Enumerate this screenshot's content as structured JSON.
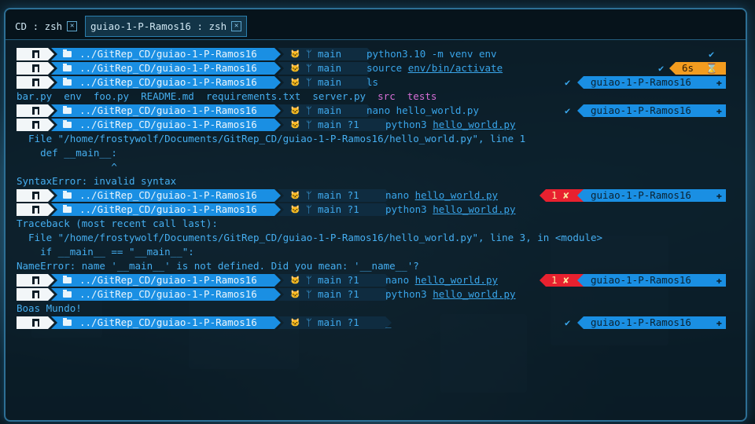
{
  "tabs": [
    {
      "label": "CD : zsh",
      "active": false
    },
    {
      "label": "guiao-1-P-Ramos16 : zsh",
      "active": true
    }
  ],
  "prompt": {
    "path": "../GitRep_CD/guiao-1-P-Ramos16",
    "branch": "main",
    "branch_dirty": "main ?1",
    "os_icon": "linux-terminal-icon",
    "folder_icon": "folder-icon",
    "git_icon": "github-icon"
  },
  "right": {
    "repo": "guiao-1-P-Ramos16",
    "time": "6s",
    "err": "1 ✘",
    "check": "✔"
  },
  "lines": [
    {
      "type": "prompt",
      "dirty": false,
      "cmd": "python3.10 -m venv env",
      "right": "check"
    },
    {
      "type": "prompt",
      "dirty": false,
      "cmd_plain": "source ",
      "cmd_ul": "env/bin/activate",
      "right": "time"
    },
    {
      "type": "prompt",
      "dirty": false,
      "cmd": "ls",
      "right": "repo"
    },
    {
      "type": "ls",
      "items": [
        "bar.py",
        "env",
        "foo.py",
        "README.md",
        "requirements.txt",
        "server.py",
        "src",
        "tests"
      ]
    },
    {
      "type": "prompt",
      "dirty": false,
      "cmd_plain": "nano hello_world.py",
      "right": "repo"
    },
    {
      "type": "prompt",
      "dirty": true,
      "cmd_plain": "python3 ",
      "cmd_ul": "hello_world.py",
      "right": "none"
    },
    {
      "type": "text",
      "text": "  File \"/home/frostywolf/Documents/GitRep_CD/guiao-1-P-Ramos16/hello_world.py\", line 1"
    },
    {
      "type": "text",
      "text": "    def __main__:"
    },
    {
      "type": "text",
      "text": "                ^"
    },
    {
      "type": "text",
      "text": "SyntaxError: invalid syntax"
    },
    {
      "type": "prompt",
      "dirty": true,
      "cmd_plain": "nano ",
      "cmd_ul": "hello_world.py",
      "right": "err"
    },
    {
      "type": "prompt",
      "dirty": true,
      "cmd_plain": "python3 ",
      "cmd_ul": "hello_world.py",
      "right": "none"
    },
    {
      "type": "text",
      "text": "Traceback (most recent call last):"
    },
    {
      "type": "text",
      "text": "  File \"/home/frostywolf/Documents/GitRep_CD/guiao-1-P-Ramos16/hello_world.py\", line 3, in <module>"
    },
    {
      "type": "text",
      "text": "    if __main__ == \"__main__\":"
    },
    {
      "type": "text",
      "text": "NameError: name '__main__' is not defined. Did you mean: '__name__'?"
    },
    {
      "type": "prompt",
      "dirty": true,
      "cmd_plain": "nano ",
      "cmd_ul": "hello_world.py",
      "right": "err"
    },
    {
      "type": "prompt",
      "dirty": true,
      "cmd_plain": "python3 ",
      "cmd_ul": "hello_world.py",
      "right": "none"
    },
    {
      "type": "text",
      "text": "Boas Mundo!"
    },
    {
      "type": "prompt",
      "dirty": true,
      "cmd_plain": "_",
      "right": "repo"
    }
  ]
}
